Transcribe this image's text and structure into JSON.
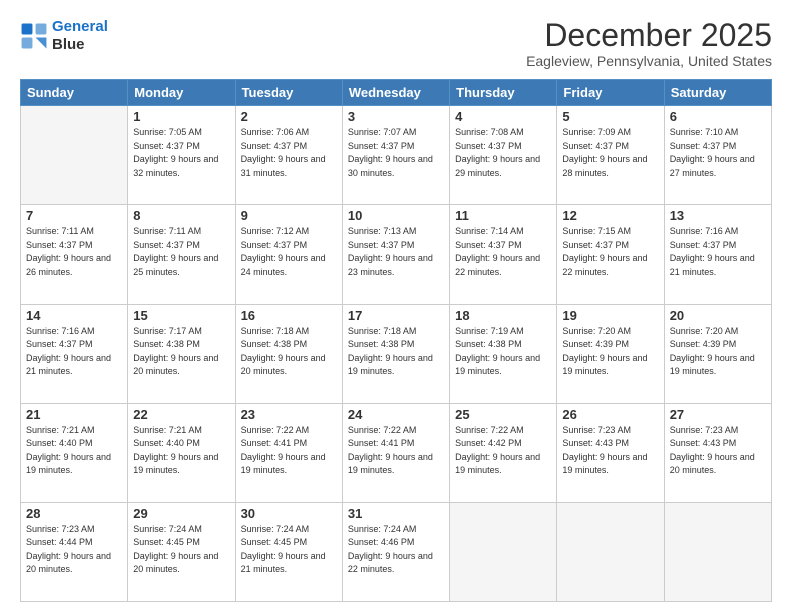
{
  "header": {
    "logo_line1": "General",
    "logo_line2": "Blue",
    "month_title": "December 2025",
    "location": "Eagleview, Pennsylvania, United States"
  },
  "weekdays": [
    "Sunday",
    "Monday",
    "Tuesday",
    "Wednesday",
    "Thursday",
    "Friday",
    "Saturday"
  ],
  "weeks": [
    [
      {
        "day": "",
        "sunrise": "",
        "sunset": "",
        "daylight": ""
      },
      {
        "day": "1",
        "sunrise": "7:05 AM",
        "sunset": "4:37 PM",
        "daylight": "9 hours and 32 minutes."
      },
      {
        "day": "2",
        "sunrise": "7:06 AM",
        "sunset": "4:37 PM",
        "daylight": "9 hours and 31 minutes."
      },
      {
        "day": "3",
        "sunrise": "7:07 AM",
        "sunset": "4:37 PM",
        "daylight": "9 hours and 30 minutes."
      },
      {
        "day": "4",
        "sunrise": "7:08 AM",
        "sunset": "4:37 PM",
        "daylight": "9 hours and 29 minutes."
      },
      {
        "day": "5",
        "sunrise": "7:09 AM",
        "sunset": "4:37 PM",
        "daylight": "9 hours and 28 minutes."
      },
      {
        "day": "6",
        "sunrise": "7:10 AM",
        "sunset": "4:37 PM",
        "daylight": "9 hours and 27 minutes."
      }
    ],
    [
      {
        "day": "7",
        "sunrise": "7:11 AM",
        "sunset": "4:37 PM",
        "daylight": "9 hours and 26 minutes."
      },
      {
        "day": "8",
        "sunrise": "7:11 AM",
        "sunset": "4:37 PM",
        "daylight": "9 hours and 25 minutes."
      },
      {
        "day": "9",
        "sunrise": "7:12 AM",
        "sunset": "4:37 PM",
        "daylight": "9 hours and 24 minutes."
      },
      {
        "day": "10",
        "sunrise": "7:13 AM",
        "sunset": "4:37 PM",
        "daylight": "9 hours and 23 minutes."
      },
      {
        "day": "11",
        "sunrise": "7:14 AM",
        "sunset": "4:37 PM",
        "daylight": "9 hours and 22 minutes."
      },
      {
        "day": "12",
        "sunrise": "7:15 AM",
        "sunset": "4:37 PM",
        "daylight": "9 hours and 22 minutes."
      },
      {
        "day": "13",
        "sunrise": "7:16 AM",
        "sunset": "4:37 PM",
        "daylight": "9 hours and 21 minutes."
      }
    ],
    [
      {
        "day": "14",
        "sunrise": "7:16 AM",
        "sunset": "4:37 PM",
        "daylight": "9 hours and 21 minutes."
      },
      {
        "day": "15",
        "sunrise": "7:17 AM",
        "sunset": "4:38 PM",
        "daylight": "9 hours and 20 minutes."
      },
      {
        "day": "16",
        "sunrise": "7:18 AM",
        "sunset": "4:38 PM",
        "daylight": "9 hours and 20 minutes."
      },
      {
        "day": "17",
        "sunrise": "7:18 AM",
        "sunset": "4:38 PM",
        "daylight": "9 hours and 19 minutes."
      },
      {
        "day": "18",
        "sunrise": "7:19 AM",
        "sunset": "4:38 PM",
        "daylight": "9 hours and 19 minutes."
      },
      {
        "day": "19",
        "sunrise": "7:20 AM",
        "sunset": "4:39 PM",
        "daylight": "9 hours and 19 minutes."
      },
      {
        "day": "20",
        "sunrise": "7:20 AM",
        "sunset": "4:39 PM",
        "daylight": "9 hours and 19 minutes."
      }
    ],
    [
      {
        "day": "21",
        "sunrise": "7:21 AM",
        "sunset": "4:40 PM",
        "daylight": "9 hours and 19 minutes."
      },
      {
        "day": "22",
        "sunrise": "7:21 AM",
        "sunset": "4:40 PM",
        "daylight": "9 hours and 19 minutes."
      },
      {
        "day": "23",
        "sunrise": "7:22 AM",
        "sunset": "4:41 PM",
        "daylight": "9 hours and 19 minutes."
      },
      {
        "day": "24",
        "sunrise": "7:22 AM",
        "sunset": "4:41 PM",
        "daylight": "9 hours and 19 minutes."
      },
      {
        "day": "25",
        "sunrise": "7:22 AM",
        "sunset": "4:42 PM",
        "daylight": "9 hours and 19 minutes."
      },
      {
        "day": "26",
        "sunrise": "7:23 AM",
        "sunset": "4:43 PM",
        "daylight": "9 hours and 19 minutes."
      },
      {
        "day": "27",
        "sunrise": "7:23 AM",
        "sunset": "4:43 PM",
        "daylight": "9 hours and 20 minutes."
      }
    ],
    [
      {
        "day": "28",
        "sunrise": "7:23 AM",
        "sunset": "4:44 PM",
        "daylight": "9 hours and 20 minutes."
      },
      {
        "day": "29",
        "sunrise": "7:24 AM",
        "sunset": "4:45 PM",
        "daylight": "9 hours and 20 minutes."
      },
      {
        "day": "30",
        "sunrise": "7:24 AM",
        "sunset": "4:45 PM",
        "daylight": "9 hours and 21 minutes."
      },
      {
        "day": "31",
        "sunrise": "7:24 AM",
        "sunset": "4:46 PM",
        "daylight": "9 hours and 22 minutes."
      },
      {
        "day": "",
        "sunrise": "",
        "sunset": "",
        "daylight": ""
      },
      {
        "day": "",
        "sunrise": "",
        "sunset": "",
        "daylight": ""
      },
      {
        "day": "",
        "sunrise": "",
        "sunset": "",
        "daylight": ""
      }
    ]
  ]
}
